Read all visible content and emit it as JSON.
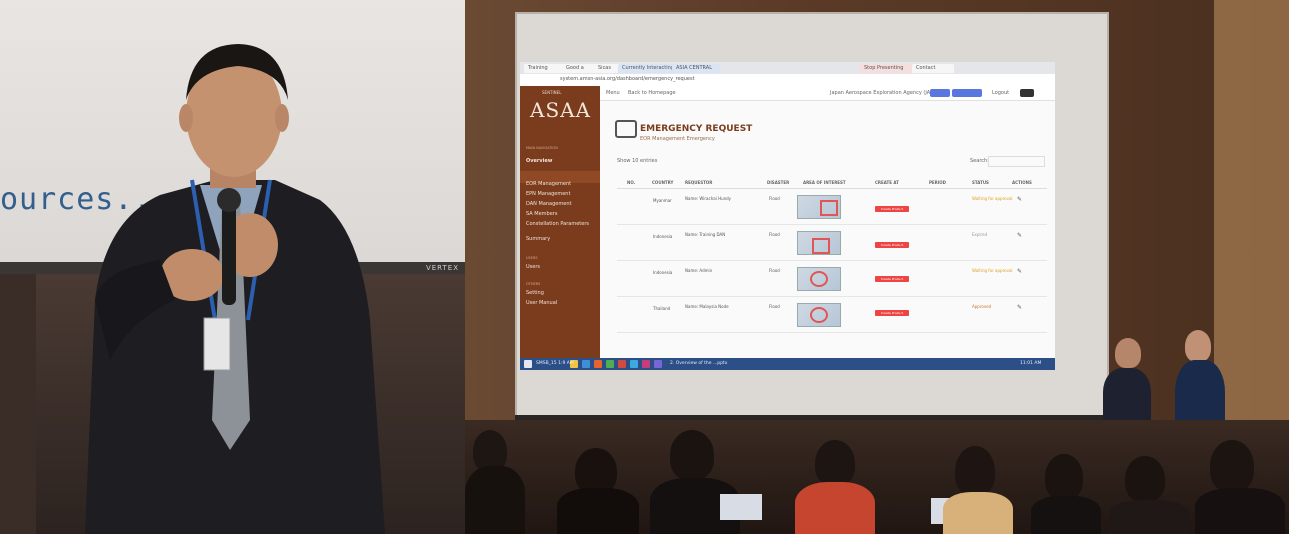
{
  "left_photo": {
    "slide_text": "ources...",
    "projector_brand": "VERTEX"
  },
  "right_photo": {
    "browser": {
      "tabs": [
        "Training",
        "Good a",
        "Sicas",
        "Currently Interacting",
        "ASIA CENTRAL",
        "Stop Presenting",
        "Contact"
      ],
      "address": "system.amsn-asia.org/dashboard/emergency_request"
    },
    "sidebar": {
      "logo": "ASAA",
      "logo_top": "SENTINEL",
      "heading_main": "MAIN NAVIGATION",
      "items": [
        "Overview",
        "EOR Management",
        "EPN Management",
        "DAN Management",
        "SA Members",
        "Constellation Parameters",
        "Summary"
      ],
      "heading_user": "USERS",
      "user_items": [
        "Users"
      ],
      "heading_other": "OTHERS",
      "other_items": [
        "Setting",
        "User Manual"
      ]
    },
    "topnav": {
      "menu": "Menu",
      "back": "Back to Homepage",
      "agency": "Japan Aerospace Exploration Agency (JAXA)",
      "logout": "Logout"
    },
    "page": {
      "title": "EMERGENCY REQUEST",
      "subtitle": "EOR Management Emergency",
      "show": "Show  10  entries",
      "search": "Search:"
    },
    "table": {
      "headers": [
        "NO.",
        "COUNTRY",
        "REQUESTOR",
        "DISASTER",
        "AREA OF INTEREST",
        "CREATE AT",
        "PERIOD",
        "STATUS",
        "ACTIONS"
      ],
      "rows": [
        {
          "country": "Myanmar",
          "requestor": "Name: Wirachai Hundy",
          "disaster": "Flood",
          "status": "Waiting for approval"
        },
        {
          "country": "Indonesia",
          "requestor": "Name: Training DAN",
          "disaster": "Flood",
          "status": "Expired"
        },
        {
          "country": "Indonesia",
          "requestor": "Name: Admin",
          "disaster": "Flood",
          "status": "Waiting for approval"
        },
        {
          "country": "Thailand",
          "requestor": "Name: Malaysia Node",
          "disaster": "Flood",
          "status": "Approved"
        }
      ],
      "button_label": "Create Product"
    },
    "taskbar": {
      "items": [
        "SMSB_15 1:9 AM",
        "2. Overview of the ...pptx"
      ],
      "clock": "11:01 AM"
    }
  }
}
